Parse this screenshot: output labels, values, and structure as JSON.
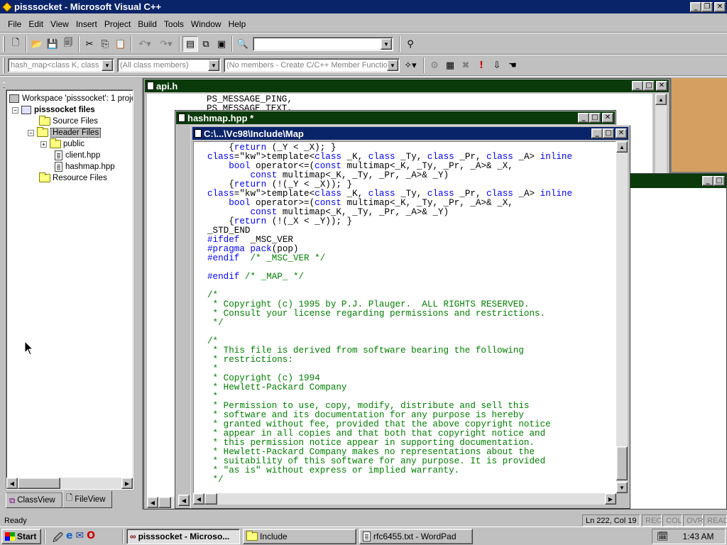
{
  "app": {
    "title": "pisssocket - Microsoft Visual C++",
    "controls": {
      "minimize": "_",
      "restore": "❐",
      "close": "✕"
    }
  },
  "menu": [
    "File",
    "Edit",
    "View",
    "Insert",
    "Project",
    "Build",
    "Tools",
    "Window",
    "Help"
  ],
  "toolbar": {
    "find_value": "",
    "wizard": {
      "class_combo": "hash_map<class K, class V",
      "filter_combo": "(All class members)",
      "members_combo": "(No members - Create C/C++ Member Function..."
    }
  },
  "workspace": {
    "root": "Workspace 'pisssocket': 1 proje",
    "project": "pisssocket files",
    "items": [
      {
        "label": "Source Files",
        "type": "folder"
      },
      {
        "label": "Header Files",
        "type": "folder-open"
      },
      {
        "label": "public",
        "type": "folder"
      },
      {
        "label": "client.hpp",
        "type": "file"
      },
      {
        "label": "hashmap.hpp",
        "type": "file"
      },
      {
        "label": "Resource Files",
        "type": "folder"
      }
    ],
    "tabs": [
      "ClassView",
      "FileView"
    ]
  },
  "windows": {
    "api": {
      "title": "api.h",
      "lines": [
        "PS_MESSAGE_PING,",
        "PS_MESSAGE_TEXT,"
      ]
    },
    "hashmap": {
      "title": "hashmap.hpp *"
    },
    "map": {
      "title": "C:\\...\\Vc98\\Include\\Map",
      "code": [
        "    {return (_Y < _X); }",
        "template<class _K, class _Ty, class _Pr, class _A> inline",
        "    bool operator<=(const multimap<_K, _Ty, _Pr, _A>& _X,",
        "        const multimap<_K, _Ty, _Pr, _A>& _Y)",
        "    {return (!(_Y < _X)); }",
        "template<class _K, class _Ty, class _Pr, class _A> inline",
        "    bool operator>=(const multimap<_K, _Ty, _Pr, _A>& _X,",
        "        const multimap<_K, _Ty, _Pr, _A>& _Y)",
        "    {return (!(_X < _Y)); }",
        "_STD_END",
        "#ifdef  _MSC_VER",
        "#pragma pack(pop)",
        "#endif  /* _MSC_VER */",
        "",
        "#endif /* _MAP_ */",
        "",
        "/*",
        " * Copyright (c) 1995 by P.J. Plauger.  ALL RIGHTS RESERVED.",
        " * Consult your license regarding permissions and restrictions.",
        " */",
        "",
        "/*",
        " * This file is derived from software bearing the following",
        " * restrictions:",
        " *",
        " * Copyright (c) 1994",
        " * Hewlett-Packard Company",
        " *",
        " * Permission to use, copy, modify, distribute and sell this",
        " * software and its documentation for any purpose is hereby",
        " * granted without fee, provided that the above copyright notice",
        " * appear in all copies and that both that copyright notice and",
        " * this permission notice appear in supporting documentation.",
        " * Hewlett-Packard Company makes no representations about the",
        " * suitability of this software for any purpose. It is provided",
        " * \"as is\" without express or implied warranty.",
        " */"
      ]
    }
  },
  "status": {
    "text": "Ready",
    "position": "Ln 222, Col 19",
    "indicators": [
      "REC",
      "COL",
      "OVR",
      "READ"
    ]
  },
  "taskbar": {
    "start": "Start",
    "tasks": [
      "pisssocket - Microso...",
      "Include",
      "rfc6455.txt - WordPad"
    ],
    "clock": "1:43 AM"
  },
  "colors": {
    "titlebar_active": "#000080",
    "titlebar_doc": "#0a3a0a",
    "desktop_orange": "#d4a060",
    "keyword": "#0000ff",
    "comment": "#008000"
  }
}
